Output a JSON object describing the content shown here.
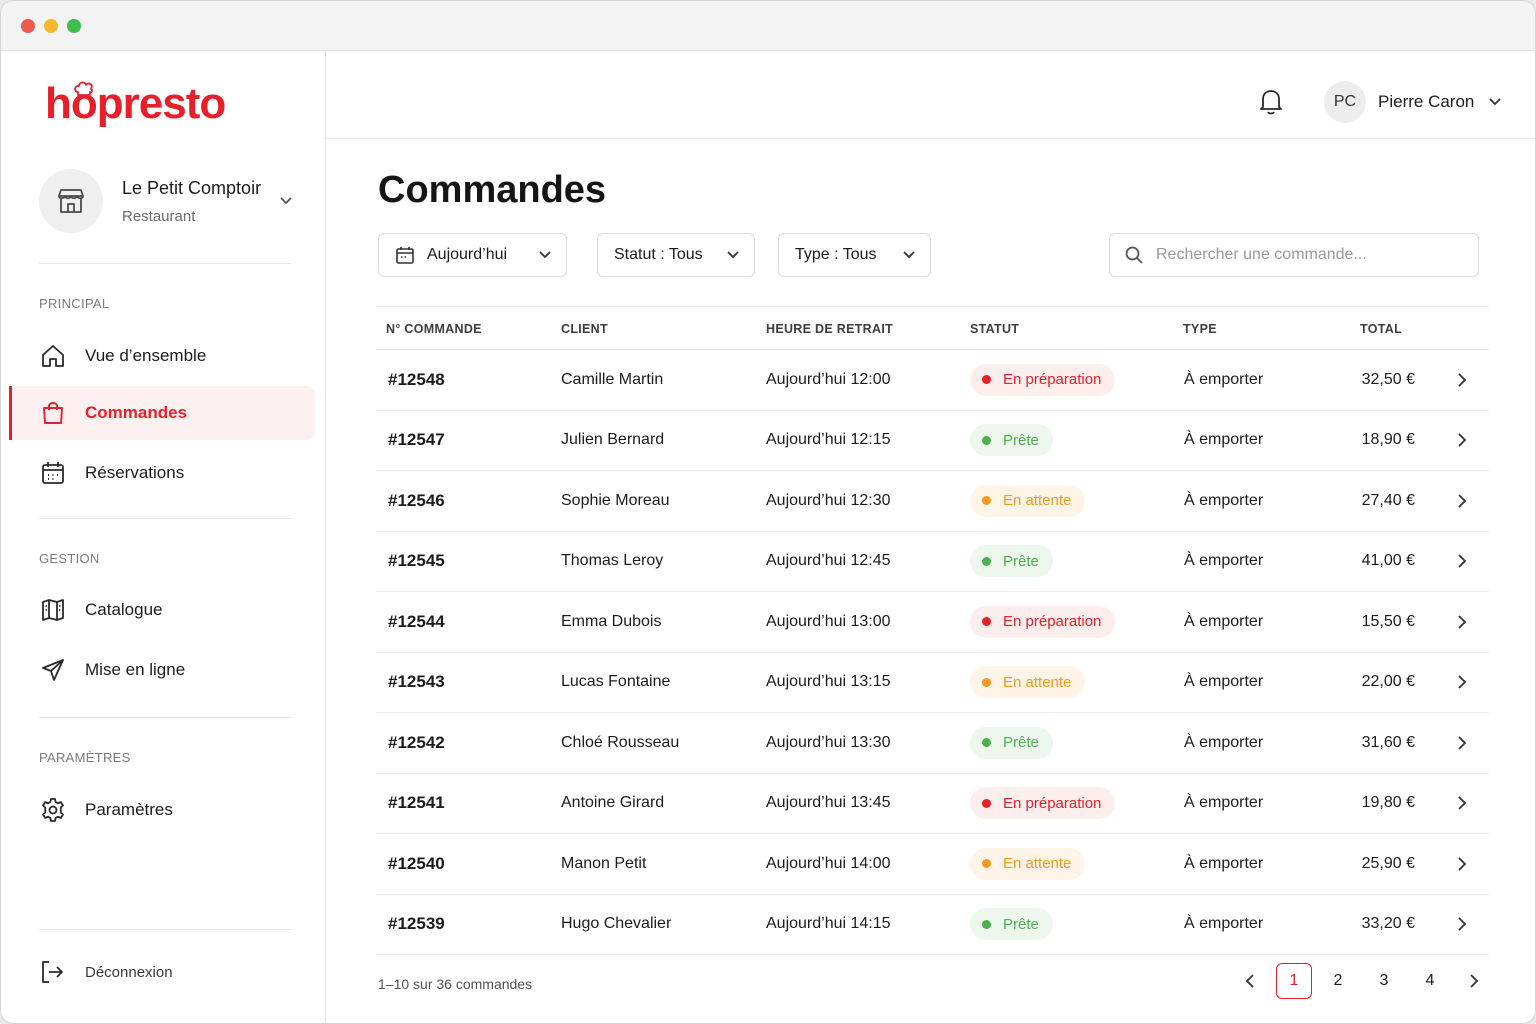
{
  "colors": {
    "accent": "#e5202b",
    "prepare": "#e5202b",
    "ready": "#4caf50",
    "waiting": "#f39a1e"
  },
  "brand": {
    "logo": "hopresto"
  },
  "store": {
    "name": "Le Petit Comptoir",
    "type": "Restaurant"
  },
  "sidebar": {
    "sections": [
      {
        "title": "PRINCIPAL"
      },
      {
        "title": "GESTION"
      },
      {
        "title": "PARAMÈTRES"
      }
    ],
    "items": [
      {
        "label": "Vue d’ensemble",
        "icon": "home-icon"
      },
      {
        "label": "Commandes",
        "icon": "shopping-bag-icon",
        "active": true
      },
      {
        "label": "Réservations",
        "icon": "calendar-icon"
      },
      {
        "label": "Catalogue",
        "icon": "book-icon"
      },
      {
        "label": "Mise en ligne",
        "icon": "send-icon"
      },
      {
        "label": "Paramètres",
        "icon": "gear-icon"
      }
    ],
    "logout": "Déconnexion"
  },
  "header": {
    "user_initials": "PC",
    "user_name": "Pierre Caron"
  },
  "page": {
    "title": "Commandes"
  },
  "filters": {
    "date": "Aujourd’hui",
    "status": "Statut : Tous",
    "type": "Type : Tous",
    "search_placeholder": "Rechercher une commande..."
  },
  "table": {
    "columns": [
      "N° COMMANDE",
      "CLIENT",
      "HEURE DE RETRAIT",
      "STATUT",
      "TYPE",
      "TOTAL"
    ],
    "rows": [
      {
        "id": "#12548",
        "client": "Camille Martin",
        "time": "Aujourd’hui 12:00",
        "status": "En préparation",
        "kind": "prepare",
        "type": "À emporter",
        "total": "32,50 €"
      },
      {
        "id": "#12547",
        "client": "Julien Bernard",
        "time": "Aujourd’hui 12:15",
        "status": "Prête",
        "kind": "ready",
        "type": "À emporter",
        "total": "18,90 €"
      },
      {
        "id": "#12546",
        "client": "Sophie Moreau",
        "time": "Aujourd’hui 12:30",
        "status": "En attente",
        "kind": "waiting",
        "type": "À emporter",
        "total": "27,40 €"
      },
      {
        "id": "#12545",
        "client": "Thomas Leroy",
        "time": "Aujourd’hui 12:45",
        "status": "Prête",
        "kind": "ready",
        "type": "À emporter",
        "total": "41,00 €"
      },
      {
        "id": "#12544",
        "client": "Emma Dubois",
        "time": "Aujourd’hui 13:00",
        "status": "En préparation",
        "kind": "prepare",
        "type": "À emporter",
        "total": "15,50 €"
      },
      {
        "id": "#12543",
        "client": "Lucas Fontaine",
        "time": "Aujourd’hui 13:15",
        "status": "En attente",
        "kind": "waiting",
        "type": "À emporter",
        "total": "22,00 €"
      },
      {
        "id": "#12542",
        "client": "Chloé Rousseau",
        "time": "Aujourd’hui 13:30",
        "status": "Prête",
        "kind": "ready",
        "type": "À emporter",
        "total": "31,60 €"
      },
      {
        "id": "#12541",
        "client": "Antoine Girard",
        "time": "Aujourd’hui 13:45",
        "status": "En préparation",
        "kind": "prepare",
        "type": "À emporter",
        "total": "19,80 €"
      },
      {
        "id": "#12540",
        "client": "Manon Petit",
        "time": "Aujourd’hui 14:00",
        "status": "En attente",
        "kind": "waiting",
        "type": "À emporter",
        "total": "25,90 €"
      },
      {
        "id": "#12539",
        "client": "Hugo Chevalier",
        "time": "Aujourd’hui 14:15",
        "status": "Prête",
        "kind": "ready",
        "type": "À emporter",
        "total": "33,20 €"
      }
    ]
  },
  "pagination": {
    "summary": "1–10 sur 36 commandes",
    "pages": [
      "1",
      "2",
      "3",
      "4"
    ],
    "current": "1"
  }
}
